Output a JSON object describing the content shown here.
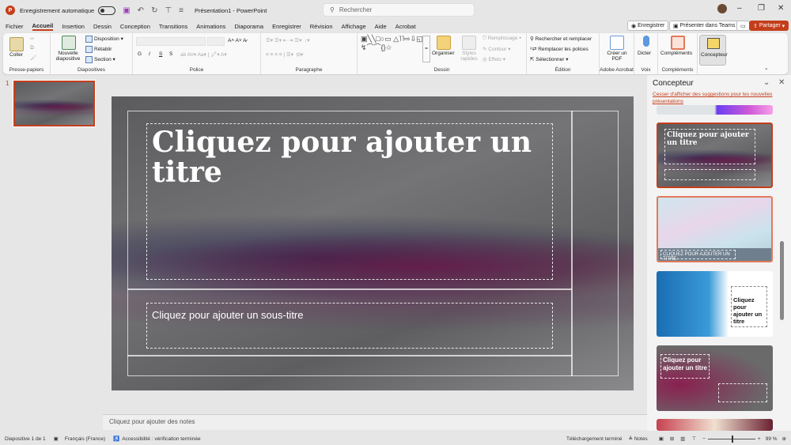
{
  "titlebar": {
    "autosave": "Enregistrement automatique",
    "title": "Présentation1  -  PowerPoint",
    "search_placeholder": "Rechercher"
  },
  "menu": [
    "Fichier",
    "Accueil",
    "Insertion",
    "Dessin",
    "Conception",
    "Transitions",
    "Animations",
    "Diaporama",
    "Enregistrer",
    "Révision",
    "Affichage",
    "Aide",
    "Acrobat"
  ],
  "actions": {
    "record": "Enregistrer",
    "teams": "Présenter dans Teams",
    "share": "Partager"
  },
  "ribbon": {
    "clipboard": {
      "paste": "Coller",
      "label": "Presse-papiers"
    },
    "slides": {
      "new_slide": "Nouvelle diapositive",
      "layout": "Disposition",
      "reset": "Rétablir",
      "section": "Section",
      "label": "Diapositives"
    },
    "font": {
      "label": "Police",
      "bold": "G",
      "italic": "I",
      "underline": "S",
      "strike": "S"
    },
    "paragraph": {
      "label": "Paragraphe"
    },
    "drawing": {
      "arrange": "Organiser",
      "quick_styles": "Styles rapides",
      "fill": "Remplissage",
      "outline": "Contour",
      "effects": "Effets",
      "label": "Dessin"
    },
    "editing": {
      "find": "Rechercher et remplacer",
      "replace_fonts": "Remplacer les polices",
      "select": "Sélectionner",
      "label": "Édition"
    },
    "acrobat": {
      "create_pdf": "Créer un PDF",
      "label": "Adobe Acrobat"
    },
    "voice": {
      "dictate": "Dicter",
      "label": "Voix"
    },
    "addins": {
      "addins": "Compléments",
      "label": "Compléments"
    },
    "designer": {
      "designer": "Concepteur"
    }
  },
  "thumbnail": {
    "number": "1"
  },
  "slide": {
    "title": "Cliquez pour ajouter un titre",
    "subtitle": "Cliquez pour ajouter un sous-titre"
  },
  "notes": {
    "placeholder": "Cliquez pour ajouter des notes"
  },
  "designer": {
    "title": "Concepteur",
    "stop_link": "Cesser d'afficher des suggestions pour les nouvelles présentations",
    "designs": [
      {
        "title": "Cliquez pour ajouter un titre"
      },
      {
        "title": "CLIQUEZ POUR AJOUTER UN TITRE"
      },
      {
        "title": "Cliquez pour ajouter un titre"
      },
      {
        "title": "Cliquez pour ajouter un titre"
      }
    ]
  },
  "status": {
    "slide": "Diapositive 1 de 1",
    "language": "Français (France)",
    "accessibility": "Accessibilité : vérification terminée",
    "download": "Téléchargement terminé",
    "notes": "Notes",
    "zoom": "99 %"
  }
}
